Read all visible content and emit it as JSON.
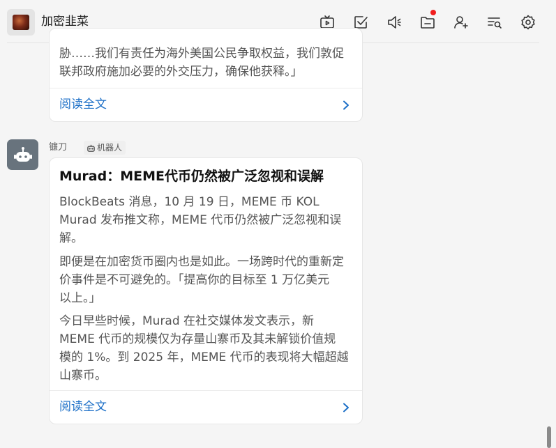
{
  "header": {
    "group_name": "加密韭菜",
    "icons": [
      "tv-icon",
      "checkbox-icon",
      "speaker-icon",
      "folder-icon",
      "add-user-icon",
      "search-list-icon",
      "gear-icon"
    ]
  },
  "messages": [
    {
      "body_lines": [
        "胁……我们有责任为海外美国公民争取权益，我们敦促",
        "联邦政府施加必要的外交压力，确保他获释。」"
      ],
      "read_more": "阅读全文"
    },
    {
      "sender": "镰刀",
      "badge": "机器人",
      "title": "Murad：MEME代币仍然被广泛忽视和误解",
      "paragraphs": [
        [
          "BlockBeats 消息，10 月 19 日，MEME 币 KOL",
          "Murad 发布推文称，MEME 代币仍然被广泛忽视和误",
          "解。"
        ],
        [
          "即便是在加密货币圈内也是如此。一场跨时代的重新定",
          "价事件是不可避免的。「提高你的目标至 1 万亿美元",
          "以上。」"
        ],
        [
          "今日早些时候，Murad 在社交媒体发文表示，新",
          "MEME 代币的规模仅为存量山寨币及其未解锁价值规",
          "模的 1%。到 2025 年，MEME 代币的表现将大幅超越",
          "山寨币。"
        ]
      ],
      "read_more": "阅读全文"
    }
  ],
  "colors": {
    "link": "#1c6fc7",
    "notification_dot": "#f01d1d",
    "bot_avatar_bg": "#68737d"
  }
}
